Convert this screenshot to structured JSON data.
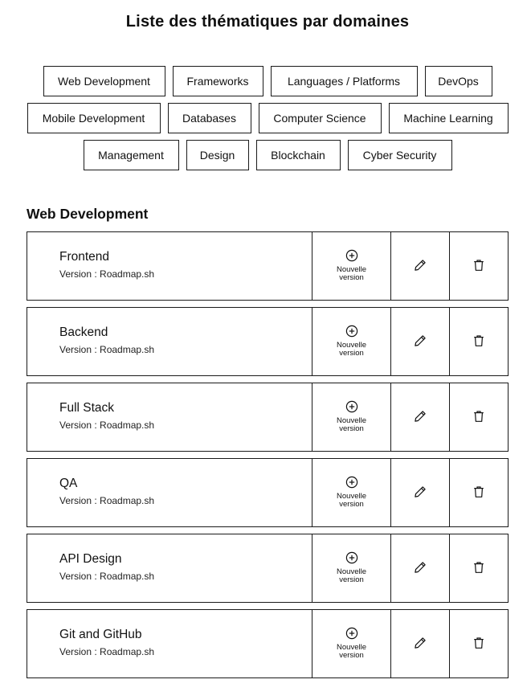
{
  "page": {
    "title": "Liste des thématiques par domaines"
  },
  "domains": {
    "rows": [
      [
        {
          "label": "Web Development"
        },
        {
          "label": "Frameworks"
        },
        {
          "label": "Languages / Platforms"
        },
        {
          "label": "DevOps"
        }
      ],
      [
        {
          "label": "Mobile Development"
        },
        {
          "label": "Databases"
        },
        {
          "label": "Computer Science"
        },
        {
          "label": "Machine Learning"
        }
      ],
      [
        {
          "label": "Management"
        },
        {
          "label": "Design"
        },
        {
          "label": "Blockchain"
        },
        {
          "label": "Cyber Security"
        }
      ]
    ]
  },
  "section": {
    "title": "Web Development"
  },
  "topics": [
    {
      "name": "Frontend",
      "version": "Version : Roadmap.sh",
      "new_label": "Nouvelle version"
    },
    {
      "name": "Backend",
      "version": "Version : Roadmap.sh",
      "new_label": "Nouvelle version"
    },
    {
      "name": "Full Stack",
      "version": "Version : Roadmap.sh",
      "new_label": "Nouvelle version"
    },
    {
      "name": "QA",
      "version": "Version : Roadmap.sh",
      "new_label": "Nouvelle version"
    },
    {
      "name": "API Design",
      "version": "Version : Roadmap.sh",
      "new_label": "Nouvelle version"
    },
    {
      "name": "Git and GitHub",
      "version": "Version : Roadmap.sh",
      "new_label": "Nouvelle version"
    }
  ],
  "icons": {
    "new_version": "plus-circle-icon",
    "edit": "pencil-icon",
    "delete": "trash-icon"
  },
  "colors": {
    "border": "#1a1a1a",
    "text": "#111111",
    "background": "#ffffff"
  }
}
